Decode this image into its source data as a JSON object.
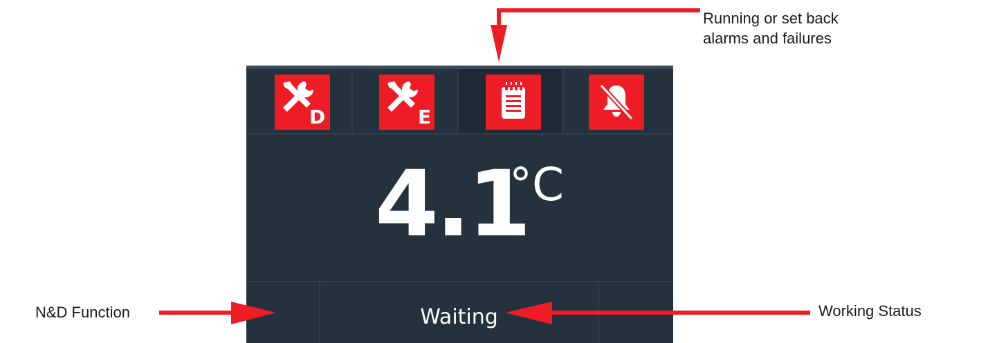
{
  "display": {
    "icons": [
      {
        "name": "maintenance-d-icon",
        "subscript": "D"
      },
      {
        "name": "maintenance-e-icon",
        "subscript": "E"
      },
      {
        "name": "notepad-icon",
        "subscript": ""
      },
      {
        "name": "bell-muted-icon",
        "subscript": ""
      }
    ],
    "temperature": {
      "value": "4.1",
      "unit": "°C"
    },
    "status": "Waiting"
  },
  "annotations": {
    "alarms_line1": "Running or set back",
    "alarms_line2": "alarms and failures",
    "nd_function": "N&D Function",
    "working_status": "Working Status"
  },
  "colors": {
    "panel_bg": "#24323e",
    "alarm_red": "#ee1c24",
    "arrow_red": "#ee1c24",
    "text_white": "#ffffff"
  }
}
